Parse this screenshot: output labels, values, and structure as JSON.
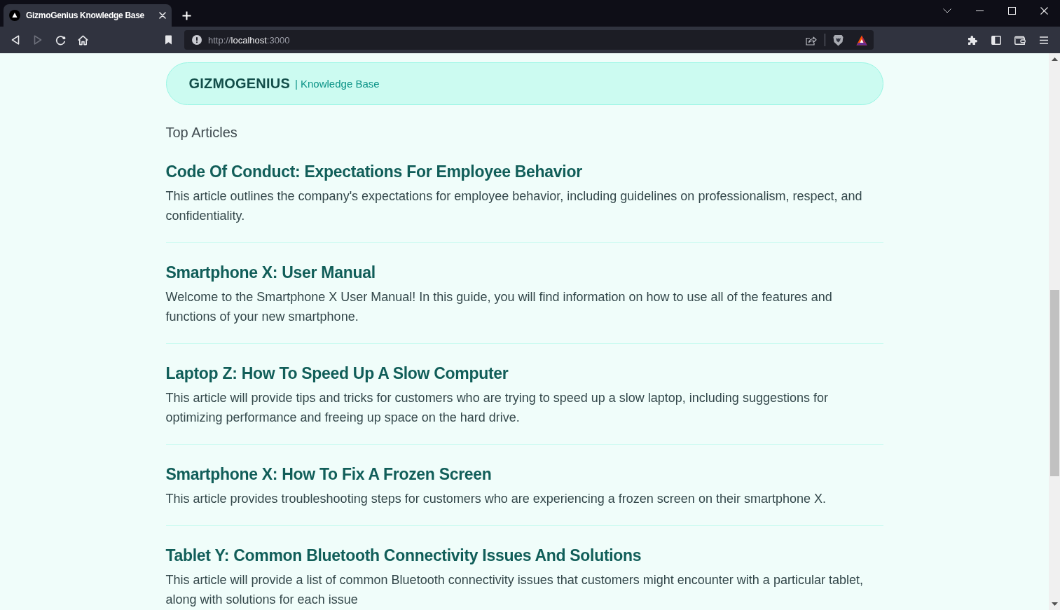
{
  "browser": {
    "tabs": [
      {
        "title": "GizmoGenius Knowledge Base",
        "selected": true
      }
    ],
    "nav_buttons": [
      {
        "kind": "back",
        "disabled": false
      },
      {
        "kind": "forward",
        "disabled": true
      },
      {
        "kind": "reload",
        "disabled": false
      },
      {
        "kind": "home",
        "disabled": false
      }
    ],
    "address_bar": {
      "url": "http://**localhost**:3000"
    }
  },
  "header": {
    "brand": "GIZMOGENIUS",
    "subtitle": "| Knowledge Base"
  },
  "section_title": "Top Articles",
  "articles": [
    {
      "title": "Code Of Conduct: Expectations For Employee Behavior",
      "summary": "This article outlines the company's expectations for employee behavior, including guidelines on professionalism, respect, and confidentiality."
    },
    {
      "title": "Smartphone X: User Manual",
      "summary": "Welcome to the Smartphone X User Manual! In this guide, you will find information on how to use all of the features and functions of your new smartphone."
    },
    {
      "title": "Laptop Z: How To Speed Up A Slow Computer",
      "summary": "This article will provide tips and tricks for customers who are trying to speed up a slow laptop, including suggestions for optimizing performance and freeing up space on the hard drive."
    },
    {
      "title": "Smartphone X: How To Fix A Frozen Screen",
      "summary": "This article provides troubleshooting steps for customers who are experiencing a frozen screen on their smartphone X."
    },
    {
      "title": "Tablet Y: Common Bluetooth Connectivity Issues And Solutions",
      "summary": "This article will provide a list of common Bluetooth connectivity issues that customers might encounter with a particular tablet, along with solutions for each issue"
    }
  ]
}
